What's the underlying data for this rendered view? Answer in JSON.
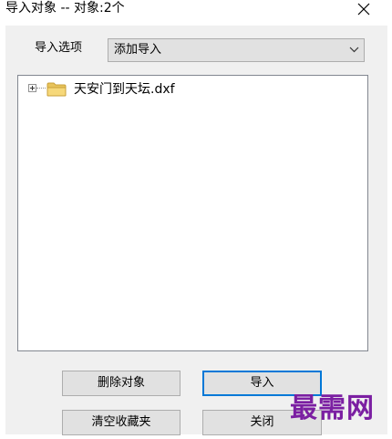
{
  "window": {
    "title": "导入对象 -- 对象:2个"
  },
  "import_options": {
    "label": "导入选项",
    "selected": "添加导入"
  },
  "tree": {
    "items": [
      {
        "label": "天安门到天坛.dxf",
        "icon": "folder-icon",
        "collapsed": true
      }
    ]
  },
  "buttons": {
    "delete": "删除对象",
    "import": "导入",
    "clear_favorites": "清空收藏夹",
    "close": "关闭"
  },
  "watermark": "最需网",
  "colors": {
    "folder": "#e8c35a",
    "default_button_border": "#0078d7",
    "watermark": "#7b1fa2"
  }
}
